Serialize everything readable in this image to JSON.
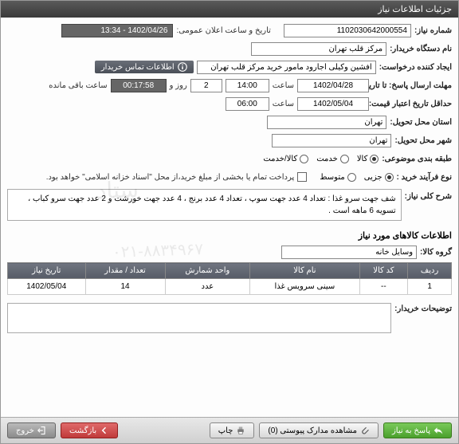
{
  "window": {
    "title": "جزئیات اطلاعات نیاز"
  },
  "fields": {
    "needNumberLabel": "شماره نیاز:",
    "needNumber": "1102030642000554",
    "publicDateLabel": "تاریخ و ساعت اعلان عمومی:",
    "publicDate": "1402/04/26 - 13:34",
    "buyerOrgLabel": "نام دستگاه خریدار:",
    "buyerOrg": "مرکز قلب تهران",
    "requesterLabel": "ایجاد کننده درخواست:",
    "requester": "افشین وکیلی اجارود مامور خرید مرکز قلب تهران",
    "contactLink": "اطلاعات تماس خریدار",
    "deadlineLabel": "مهلت ارسال پاسخ: تا تاریخ:",
    "deadlineDate": "1402/04/28",
    "timeLabel": "ساعت",
    "deadlineTime": "14:00",
    "dayLabel": "روز و",
    "daysLeft": "2",
    "remainLabel": "ساعت باقی مانده",
    "remainTime": "00:17:58",
    "validityLabel": "حداقل تاریخ اعتبار قیمت: تا تاریخ:",
    "validityDate": "1402/05/04",
    "validityTime": "06:00",
    "deliveryProvinceLabel": "استان محل تحویل:",
    "deliveryProvince": "تهران",
    "deliveryCityLabel": "شهر محل تحویل:",
    "deliveryCity": "تهران",
    "categoryLabel": "طبقه بندی موضوعی:",
    "catGoods": "کالا",
    "catService": "خدمت",
    "catBoth": "کالا/خدمت",
    "processLabel": "نوع فرآیند خرید :",
    "procPartial": "جزیی",
    "procMedium": "متوسط",
    "paymentNote": "پرداخت تمام یا بخشی از مبلغ خرید،از محل \"اسناد خزانه اسلامی\" خواهد بود.",
    "descLabel": "شرح کلی نیاز:",
    "desc": "شف جهت سرو غذا : تعداد 4 عدد جهت سوپ ، تعداد 4 عدد برنج ، 4 عدد جهت خورشت و 2 عدد جهت سرو کباب ، تسویه 6 ماهه است .",
    "itemsTitle": "اطلاعات کالاهای مورد نیاز",
    "groupLabel": "گروه کالا:",
    "groupValue": "وسایل خانه",
    "buyerCommentLabel": "توضیحات خریدار:"
  },
  "table": {
    "headers": {
      "row": "ردیف",
      "code": "کد کالا",
      "name": "نام کالا",
      "unit": "واحد شمارش",
      "qty": "تعداد / مقدار",
      "needDate": "تاریخ نیاز"
    },
    "rows": [
      {
        "row": "1",
        "code": "--",
        "name": "سینی سرویس غذا",
        "unit": "عدد",
        "qty": "14",
        "needDate": "1402/05/04"
      }
    ]
  },
  "footer": {
    "respond": "پاسخ به نیاز",
    "attachments": "مشاهده مدارک پیوستی (0)",
    "print": "چاپ",
    "back": "بازگشت",
    "exit": "خروج"
  }
}
